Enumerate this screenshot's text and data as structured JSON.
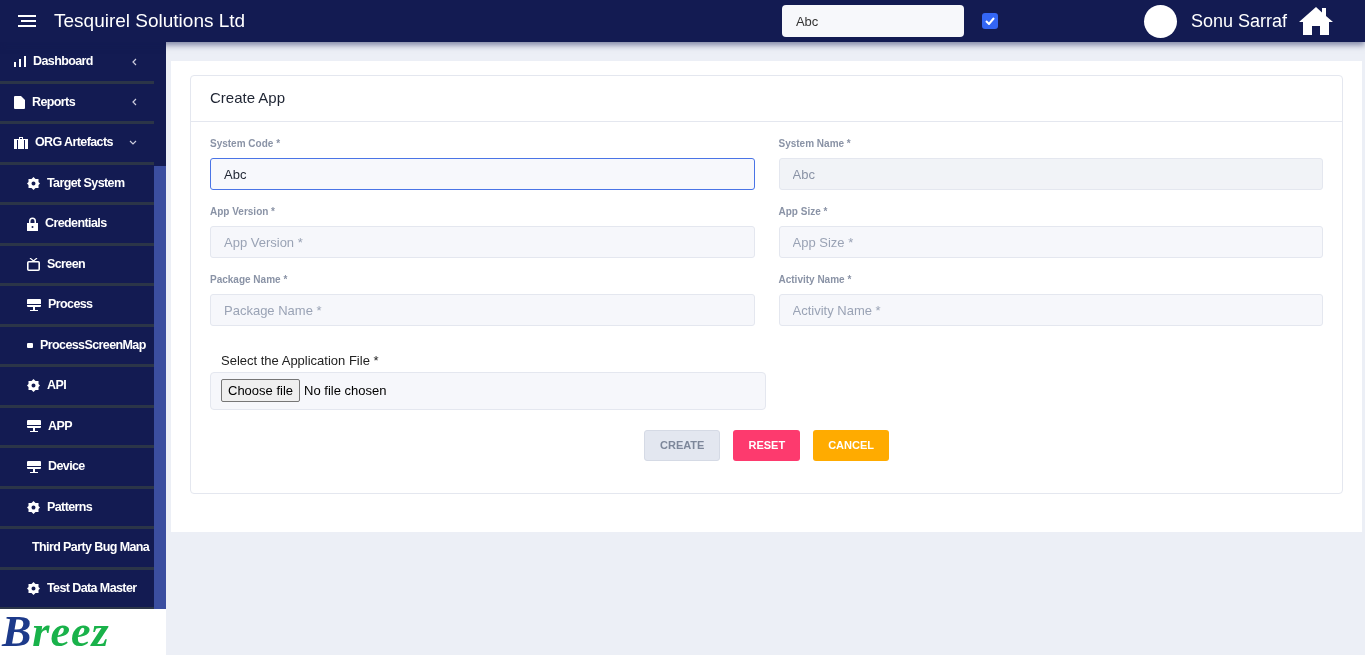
{
  "header": {
    "title": "Tesquirel Solutions Ltd",
    "search_value": "Abc",
    "checkbox_checked": true,
    "user_name": "Sonu Sarraf"
  },
  "sidebar": {
    "items": [
      {
        "label": "Dashboard",
        "expanded": false
      },
      {
        "label": "Reports",
        "expanded": false
      },
      {
        "label": "ORG Artefacts",
        "expanded": true,
        "children": [
          {
            "label": "Target System"
          },
          {
            "label": "Credentials"
          },
          {
            "label": "Screen"
          },
          {
            "label": "Process"
          },
          {
            "label": "ProcessScreenMap"
          },
          {
            "label": "API"
          },
          {
            "label": "APP"
          },
          {
            "label": "Device"
          },
          {
            "label": "Patterns"
          },
          {
            "label": "Third Party Bug Mana"
          },
          {
            "label": "Test Data Master"
          }
        ]
      }
    ],
    "logo": "Breez"
  },
  "form": {
    "title": "Create App",
    "fields": [
      {
        "label": "System Code *",
        "value": "Abc",
        "focused": true,
        "disabled": false
      },
      {
        "label": "System Name *",
        "value": "Abc",
        "focused": false,
        "disabled": true
      },
      {
        "label": "App Version *",
        "placeholder": "App Version *",
        "focused": false,
        "disabled": false
      },
      {
        "label": "App Size *",
        "placeholder": "App Size *",
        "focused": false,
        "disabled": false
      },
      {
        "label": "Package Name *",
        "placeholder": "Package Name *",
        "focused": false,
        "disabled": false
      },
      {
        "label": "Activity Name *",
        "placeholder": "Activity Name *",
        "focused": false,
        "disabled": false
      }
    ],
    "file": {
      "label": "Select the Application File *",
      "button": "Choose file",
      "status": "No file chosen"
    },
    "buttons": [
      {
        "label": "CREATE",
        "kind": "create",
        "disabled": true
      },
      {
        "label": "RESET",
        "kind": "reset",
        "disabled": false
      },
      {
        "label": "CANCEL",
        "kind": "cancel",
        "disabled": false
      }
    ]
  }
}
